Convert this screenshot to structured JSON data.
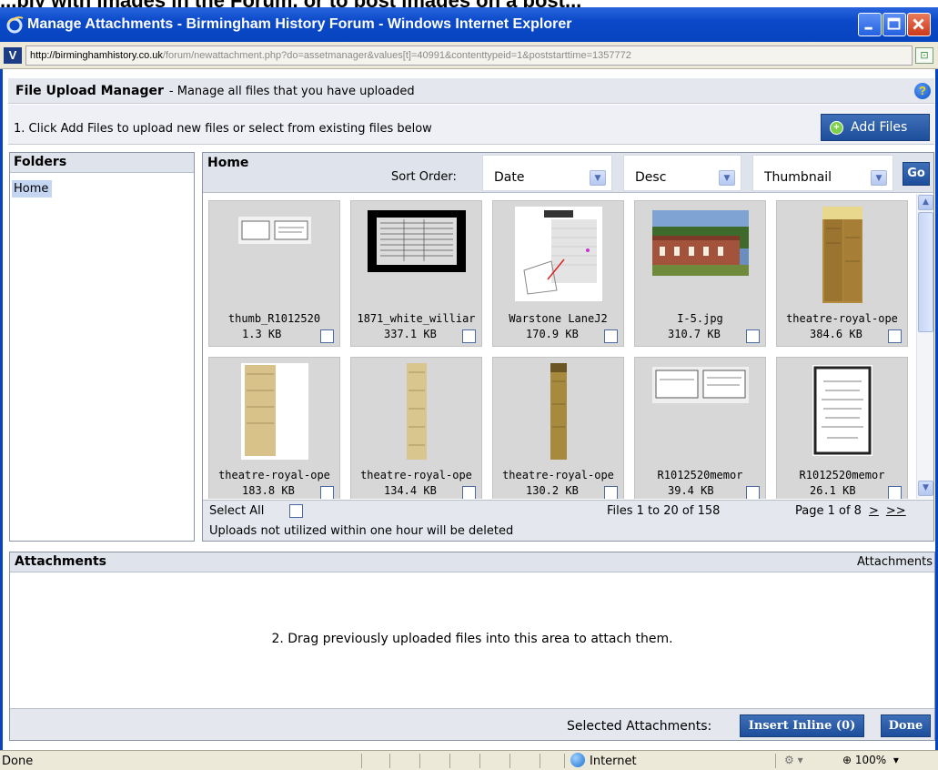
{
  "window": {
    "title": "Manage Attachments - Birmingham History Forum - Windows Internet Explorer",
    "url_host": "http://birminghamhistory.co.uk",
    "url_rest": "/forum/newattachment.php?do=assetmanager&values[t]=40991&contenttypeid=1&poststarttime=1357772"
  },
  "manager": {
    "title": "File Upload Manager",
    "subtitle": "- Manage all files that you have uploaded",
    "step1": "1. Click Add Files to upload new files or select from existing files below",
    "add_files": "Add Files"
  },
  "folders": {
    "header": "Folders",
    "home": "Home"
  },
  "browser": {
    "header": "Home",
    "sort_label": "Sort Order:",
    "sort_by": "Date",
    "direction": "Desc",
    "view": "Thumbnail",
    "go": "Go"
  },
  "files": [
    {
      "name": "thumb_R1012520",
      "size": "1.3 KB"
    },
    {
      "name": "1871_white_williar",
      "size": "337.1 KB"
    },
    {
      "name": "Warstone LaneJ2",
      "size": "170.9 KB"
    },
    {
      "name": "I-5.jpg",
      "size": "310.7 KB"
    },
    {
      "name": "theatre-royal-ope",
      "size": "384.6 KB"
    },
    {
      "name": "theatre-royal-ope",
      "size": "183.8 KB"
    },
    {
      "name": "theatre-royal-ope",
      "size": "134.4 KB"
    },
    {
      "name": "theatre-royal-ope",
      "size": "130.2 KB"
    },
    {
      "name": "R1012520memor",
      "size": "39.4 KB"
    },
    {
      "name": "R1012520memor",
      "size": "26.1 KB"
    }
  ],
  "footer": {
    "select_all": "Select All",
    "file_count": "Files 1 to 20 of 158",
    "page": "Page 1 of 8",
    "next": ">",
    "last": ">>",
    "note": "Uploads not utilized within one hour will be deleted"
  },
  "attachments": {
    "header": "Attachments",
    "header_right": "Attachments",
    "message": "2. Drag previously uploaded files into this area to attach them.",
    "selected_label": "Selected Attachments:",
    "insert_inline": "Insert Inline (0)",
    "done": "Done"
  },
  "status": {
    "text": "Done",
    "zone": "Internet",
    "zoom": "100%"
  }
}
